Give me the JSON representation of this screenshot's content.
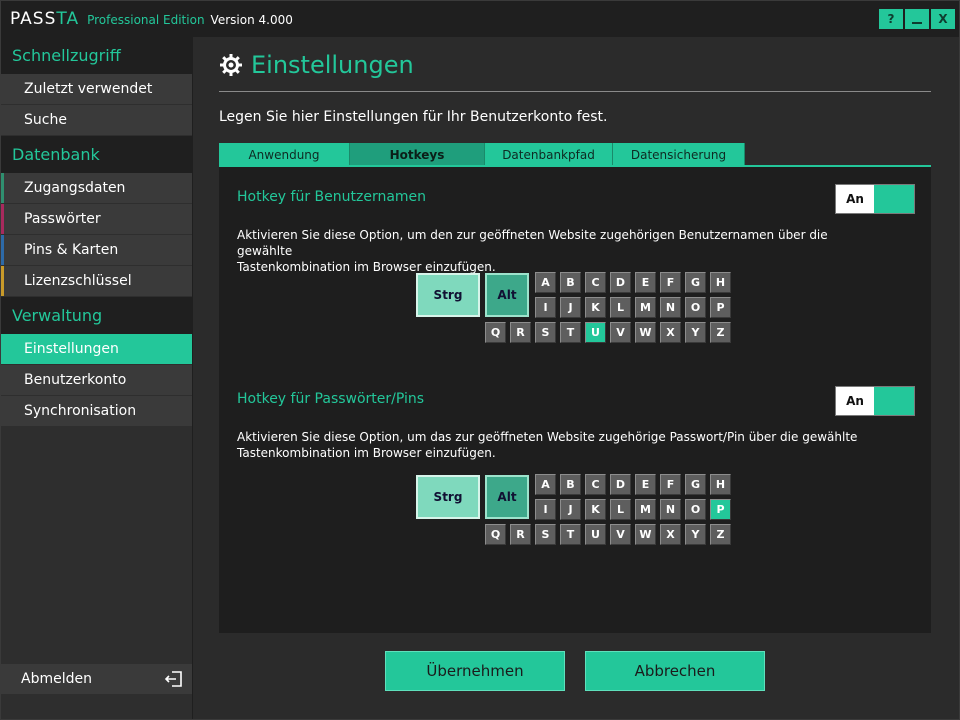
{
  "app": {
    "logo_pass": "PASS",
    "logo_ta": "TA",
    "edition": "Professional Edition",
    "version": "Version 4.000"
  },
  "window_buttons": {
    "help": "?",
    "minimize": "_",
    "close": "X"
  },
  "sidebar": {
    "sections": [
      {
        "title": "Schnellzugriff",
        "items": [
          "Zuletzt verwendet",
          "Suche"
        ]
      },
      {
        "title": "Datenbank",
        "items": [
          "Zugangsdaten",
          "Passwörter",
          "Pins & Karten",
          "Lizenzschlüssel"
        ]
      },
      {
        "title": "Verwaltung",
        "items": [
          "Einstellungen",
          "Benutzerkonto",
          "Synchronisation"
        ]
      }
    ],
    "logout_label": "Abmelden"
  },
  "main": {
    "title": "Einstellungen",
    "subtitle": "Legen Sie hier Einstellungen für Ihr Benutzerkonto fest.",
    "tabs": [
      "Anwendung",
      "Hotkeys",
      "Datenbankpfad",
      "Datensicherung"
    ],
    "active_tab": "Hotkeys"
  },
  "hotkeys": [
    {
      "title": "Hotkey für Benutzernamen",
      "desc1": "Aktivieren Sie diese Option, um den zur geöffneten Website zugehörigen Benutzernamen über die gewählte",
      "desc2": "Tastenkombination im Browser einzufügen.",
      "toggle": "An",
      "modifiers": [
        "Strg",
        "Alt"
      ],
      "selected_key": "U"
    },
    {
      "title": "Hotkey für Passwörter/Pins",
      "desc1": "Aktivieren Sie diese Option, um das zur geöffneten Website zugehörige Passwort/Pin über die gewählte",
      "desc2": "Tastenkombination im Browser einzufügen.",
      "toggle": "An",
      "modifiers": [
        "Strg",
        "Alt"
      ],
      "selected_key": "P"
    }
  ],
  "key_rows": [
    [
      "A",
      "B",
      "C",
      "D",
      "E",
      "F",
      "G",
      "H"
    ],
    [
      "I",
      "J",
      "K",
      "L",
      "M",
      "N",
      "O",
      "P"
    ],
    [
      "Q",
      "R",
      "S",
      "T",
      "U",
      "V",
      "W",
      "X",
      "Y",
      "Z"
    ]
  ],
  "buttons": {
    "apply": "Übernehmen",
    "cancel": "Abbrechen"
  },
  "colors": {
    "accent": "#23c79a",
    "background": "#2b2b2b",
    "panel": "#1e1e1e"
  }
}
